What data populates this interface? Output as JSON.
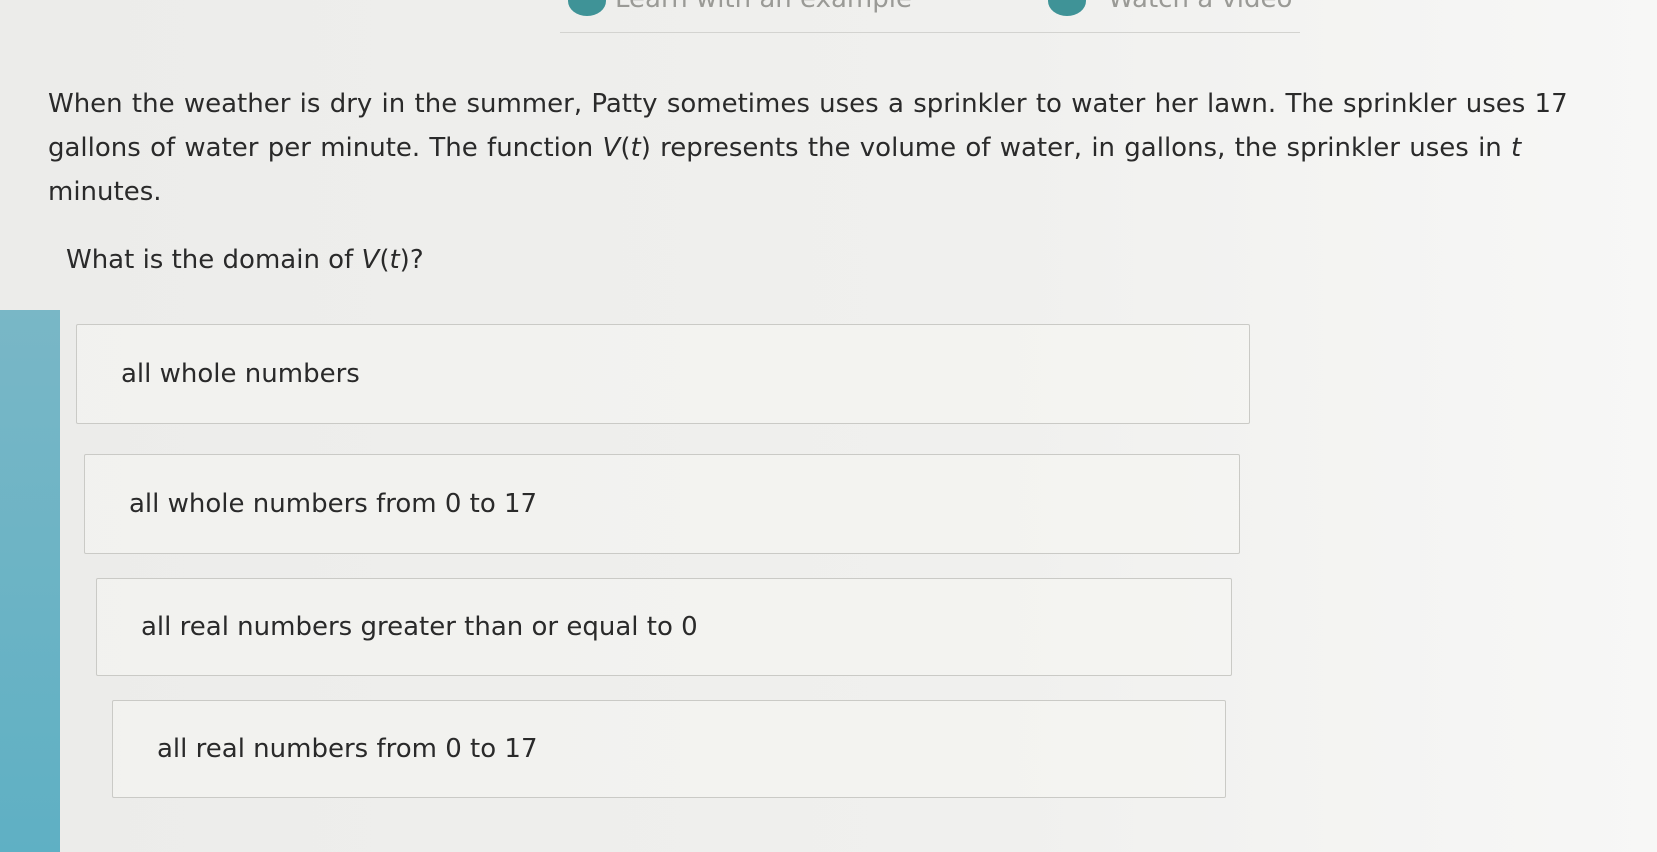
{
  "header": {
    "left_link": "Learn with an example",
    "right_link": "Watch a video"
  },
  "question": {
    "sentence_1": "When the weather is dry in the summer, Patty sometimes uses a sprinkler to water her lawn.",
    "sentence_2_before": "The sprinkler uses 17 gallons of water per minute. The function ",
    "function_name": "V",
    "function_var": "t",
    "sentence_2_after": " represents the volume of water, in gallons, the sprinkler uses in ",
    "variable": "t",
    "sentence_2_end": " minutes."
  },
  "prompt": {
    "before": "What is the domain of ",
    "function_name": "V",
    "function_var": "t",
    "after": "?"
  },
  "options": [
    "all whole numbers",
    "all whole numbers from 0 to 17",
    "all real numbers greater than or equal to 0",
    "all real numbers from 0 to 17"
  ],
  "colors": {
    "accent_teal": "#3f9397",
    "left_edge_blue": "#5fb0c4",
    "option_border": "#cacac6"
  }
}
